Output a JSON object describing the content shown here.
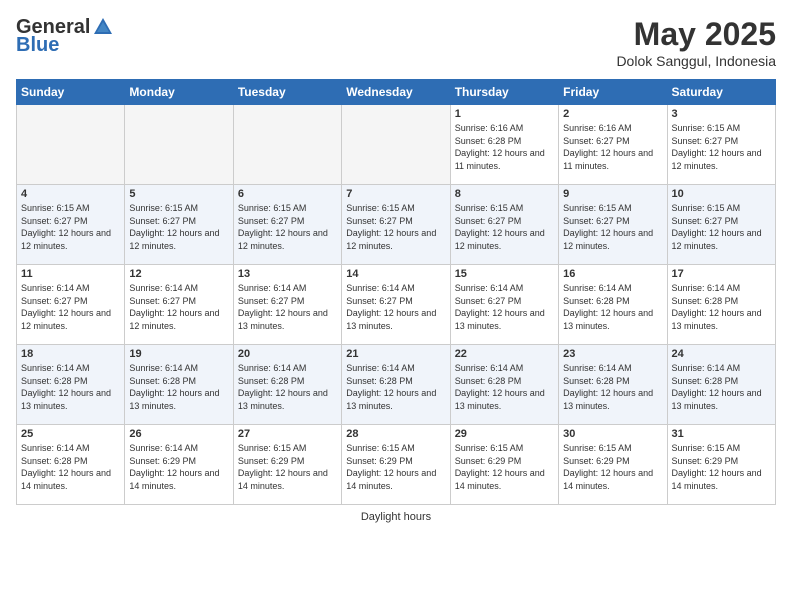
{
  "header": {
    "logo_general": "General",
    "logo_blue": "Blue",
    "month_title": "May 2025",
    "location": "Dolok Sanggul, Indonesia"
  },
  "days_of_week": [
    "Sunday",
    "Monday",
    "Tuesday",
    "Wednesday",
    "Thursday",
    "Friday",
    "Saturday"
  ],
  "footer": {
    "daylight_label": "Daylight hours"
  },
  "weeks": [
    [
      {
        "day": "",
        "empty": true
      },
      {
        "day": "",
        "empty": true
      },
      {
        "day": "",
        "empty": true
      },
      {
        "day": "",
        "empty": true
      },
      {
        "day": "1",
        "sunrise": "Sunrise: 6:16 AM",
        "sunset": "Sunset: 6:28 PM",
        "daylight": "Daylight: 12 hours and 11 minutes."
      },
      {
        "day": "2",
        "sunrise": "Sunrise: 6:16 AM",
        "sunset": "Sunset: 6:27 PM",
        "daylight": "Daylight: 12 hours and 11 minutes."
      },
      {
        "day": "3",
        "sunrise": "Sunrise: 6:15 AM",
        "sunset": "Sunset: 6:27 PM",
        "daylight": "Daylight: 12 hours and 12 minutes."
      }
    ],
    [
      {
        "day": "4",
        "sunrise": "Sunrise: 6:15 AM",
        "sunset": "Sunset: 6:27 PM",
        "daylight": "Daylight: 12 hours and 12 minutes."
      },
      {
        "day": "5",
        "sunrise": "Sunrise: 6:15 AM",
        "sunset": "Sunset: 6:27 PM",
        "daylight": "Daylight: 12 hours and 12 minutes."
      },
      {
        "day": "6",
        "sunrise": "Sunrise: 6:15 AM",
        "sunset": "Sunset: 6:27 PM",
        "daylight": "Daylight: 12 hours and 12 minutes."
      },
      {
        "day": "7",
        "sunrise": "Sunrise: 6:15 AM",
        "sunset": "Sunset: 6:27 PM",
        "daylight": "Daylight: 12 hours and 12 minutes."
      },
      {
        "day": "8",
        "sunrise": "Sunrise: 6:15 AM",
        "sunset": "Sunset: 6:27 PM",
        "daylight": "Daylight: 12 hours and 12 minutes."
      },
      {
        "day": "9",
        "sunrise": "Sunrise: 6:15 AM",
        "sunset": "Sunset: 6:27 PM",
        "daylight": "Daylight: 12 hours and 12 minutes."
      },
      {
        "day": "10",
        "sunrise": "Sunrise: 6:15 AM",
        "sunset": "Sunset: 6:27 PM",
        "daylight": "Daylight: 12 hours and 12 minutes."
      }
    ],
    [
      {
        "day": "11",
        "sunrise": "Sunrise: 6:14 AM",
        "sunset": "Sunset: 6:27 PM",
        "daylight": "Daylight: 12 hours and 12 minutes."
      },
      {
        "day": "12",
        "sunrise": "Sunrise: 6:14 AM",
        "sunset": "Sunset: 6:27 PM",
        "daylight": "Daylight: 12 hours and 12 minutes."
      },
      {
        "day": "13",
        "sunrise": "Sunrise: 6:14 AM",
        "sunset": "Sunset: 6:27 PM",
        "daylight": "Daylight: 12 hours and 13 minutes."
      },
      {
        "day": "14",
        "sunrise": "Sunrise: 6:14 AM",
        "sunset": "Sunset: 6:27 PM",
        "daylight": "Daylight: 12 hours and 13 minutes."
      },
      {
        "day": "15",
        "sunrise": "Sunrise: 6:14 AM",
        "sunset": "Sunset: 6:27 PM",
        "daylight": "Daylight: 12 hours and 13 minutes."
      },
      {
        "day": "16",
        "sunrise": "Sunrise: 6:14 AM",
        "sunset": "Sunset: 6:28 PM",
        "daylight": "Daylight: 12 hours and 13 minutes."
      },
      {
        "day": "17",
        "sunrise": "Sunrise: 6:14 AM",
        "sunset": "Sunset: 6:28 PM",
        "daylight": "Daylight: 12 hours and 13 minutes."
      }
    ],
    [
      {
        "day": "18",
        "sunrise": "Sunrise: 6:14 AM",
        "sunset": "Sunset: 6:28 PM",
        "daylight": "Daylight: 12 hours and 13 minutes."
      },
      {
        "day": "19",
        "sunrise": "Sunrise: 6:14 AM",
        "sunset": "Sunset: 6:28 PM",
        "daylight": "Daylight: 12 hours and 13 minutes."
      },
      {
        "day": "20",
        "sunrise": "Sunrise: 6:14 AM",
        "sunset": "Sunset: 6:28 PM",
        "daylight": "Daylight: 12 hours and 13 minutes."
      },
      {
        "day": "21",
        "sunrise": "Sunrise: 6:14 AM",
        "sunset": "Sunset: 6:28 PM",
        "daylight": "Daylight: 12 hours and 13 minutes."
      },
      {
        "day": "22",
        "sunrise": "Sunrise: 6:14 AM",
        "sunset": "Sunset: 6:28 PM",
        "daylight": "Daylight: 12 hours and 13 minutes."
      },
      {
        "day": "23",
        "sunrise": "Sunrise: 6:14 AM",
        "sunset": "Sunset: 6:28 PM",
        "daylight": "Daylight: 12 hours and 13 minutes."
      },
      {
        "day": "24",
        "sunrise": "Sunrise: 6:14 AM",
        "sunset": "Sunset: 6:28 PM",
        "daylight": "Daylight: 12 hours and 13 minutes."
      }
    ],
    [
      {
        "day": "25",
        "sunrise": "Sunrise: 6:14 AM",
        "sunset": "Sunset: 6:28 PM",
        "daylight": "Daylight: 12 hours and 14 minutes."
      },
      {
        "day": "26",
        "sunrise": "Sunrise: 6:14 AM",
        "sunset": "Sunset: 6:29 PM",
        "daylight": "Daylight: 12 hours and 14 minutes."
      },
      {
        "day": "27",
        "sunrise": "Sunrise: 6:15 AM",
        "sunset": "Sunset: 6:29 PM",
        "daylight": "Daylight: 12 hours and 14 minutes."
      },
      {
        "day": "28",
        "sunrise": "Sunrise: 6:15 AM",
        "sunset": "Sunset: 6:29 PM",
        "daylight": "Daylight: 12 hours and 14 minutes."
      },
      {
        "day": "29",
        "sunrise": "Sunrise: 6:15 AM",
        "sunset": "Sunset: 6:29 PM",
        "daylight": "Daylight: 12 hours and 14 minutes."
      },
      {
        "day": "30",
        "sunrise": "Sunrise: 6:15 AM",
        "sunset": "Sunset: 6:29 PM",
        "daylight": "Daylight: 12 hours and 14 minutes."
      },
      {
        "day": "31",
        "sunrise": "Sunrise: 6:15 AM",
        "sunset": "Sunset: 6:29 PM",
        "daylight": "Daylight: 12 hours and 14 minutes."
      }
    ]
  ]
}
